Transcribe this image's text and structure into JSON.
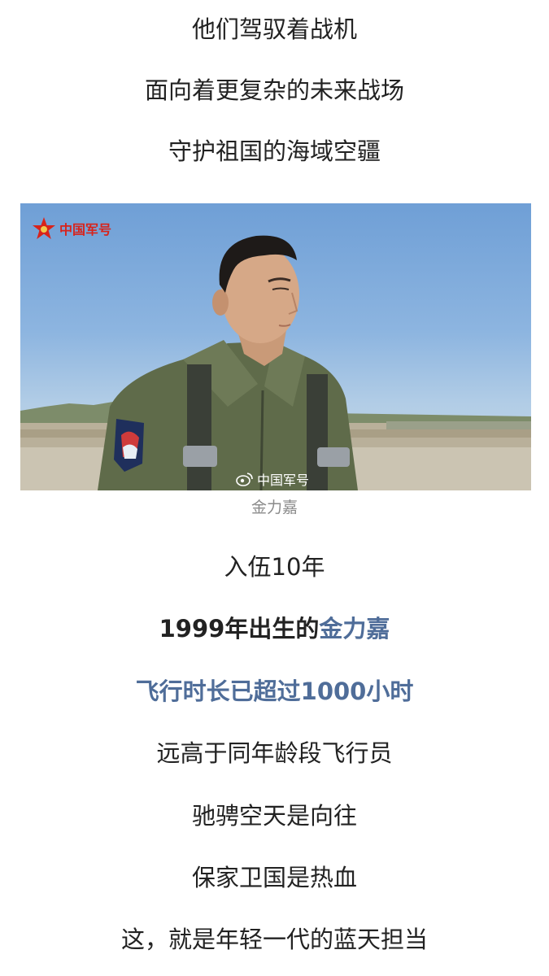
{
  "intro": {
    "line1": "他们驾驭着战机",
    "line2": "面向着更复杂的未来战场",
    "line3": "守护祖国的海域空疆"
  },
  "photo": {
    "logo_text": "中国军号",
    "watermark_text": "中国军号",
    "caption": "金力嘉"
  },
  "body": {
    "line1": "入伍10年",
    "line2_part1": "1999年出生的",
    "line2_part2": "金力嘉",
    "line3": "飞行时长已超过1000小时",
    "line4": "远高于同年龄段飞行员",
    "line5": "驰骋空天是向往",
    "line6": "保家卫国是热血",
    "line7": "这，就是年轻一代的蓝天担当"
  },
  "colors": {
    "accent": "#4f6d99",
    "text": "#222222",
    "caption": "#8a8a8a",
    "logo_red": "#d8231b"
  }
}
